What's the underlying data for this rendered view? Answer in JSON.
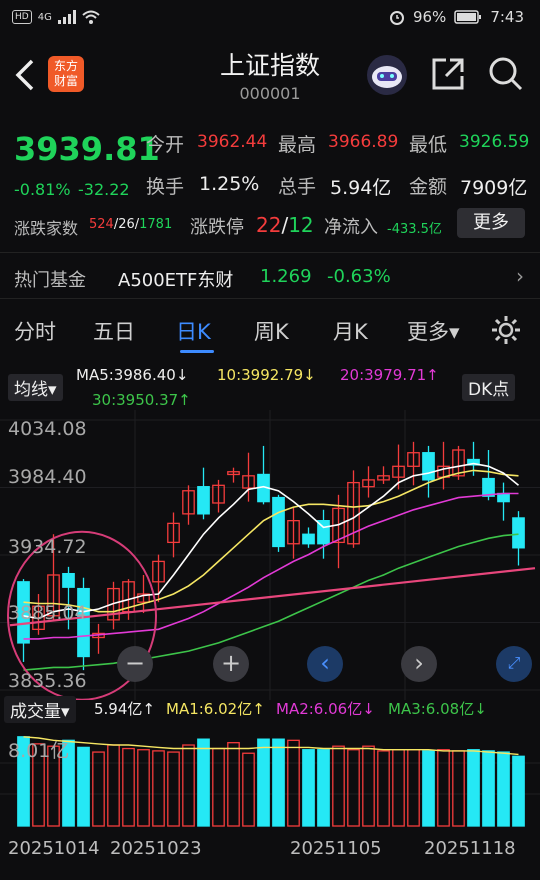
{
  "status": {
    "signal": "4G",
    "hd": "HD",
    "battery": "96%",
    "time": "7:43"
  },
  "header": {
    "logo_text_1": "东方",
    "logo_text_2": "财富",
    "title": "上证指数",
    "code": "000001"
  },
  "quote": {
    "price": "3939.81",
    "change_pct": "-0.81%",
    "change": "-32.22",
    "open_label": "今开",
    "open": "3962.44",
    "high_label": "最高",
    "high": "3966.89",
    "low_label": "最低",
    "low": "3926.59",
    "turnover_label": "换手",
    "turnover": "1.25%",
    "volume_label": "总手",
    "volume": "5.94亿",
    "amount_label": "金额",
    "amount": "7909亿",
    "breadth_label": "涨跌家数",
    "breadth_up": "524",
    "breadth_flat": "/26/",
    "breadth_down": "1781",
    "limit_label": "涨跌停",
    "limit_up": "22",
    "limit_sep": "/",
    "limit_down": "12",
    "netflow_label": "净流入",
    "netflow": "-433.5亿",
    "more_button": "更多"
  },
  "fund": {
    "label": "热门基金",
    "name": "A500ETF东财",
    "price": "1.269",
    "change": "-0.63%",
    "arrow": "›"
  },
  "tabs": {
    "items": [
      "分时",
      "五日",
      "日K",
      "周K",
      "月K",
      "更多▾"
    ],
    "active": "日K"
  },
  "chart": {
    "indicator_select": "均线▾",
    "ma5": "MA5:3986.40↓",
    "ma10": "10:3992.79↓",
    "ma20": "20:3979.71↑",
    "ma30": "30:3950.37↑",
    "dk_button": "DK点",
    "y_labels": [
      "4034.08",
      "3984.40",
      "3934.72",
      "3885.04",
      "3835.36"
    ],
    "volume_select": "成交量▾",
    "vol": "5.94亿↑",
    "vol_ma1": "MA1:6.02亿↑",
    "vol_ma2": "MA2:6.06亿↓",
    "vol_ma3": "MA3:6.08亿↓",
    "vol_axis": "8.01亿",
    "dates": [
      "20251014",
      "20251023",
      "20251105",
      "20251118"
    ],
    "colors": {
      "up": "#f43c3c",
      "down": "#25e8f5",
      "ma5": "#ffffff",
      "ma10": "#f5e663",
      "ma20": "#e23ad6",
      "ma30": "#3dc44a"
    }
  },
  "chart_data": {
    "type": "candlestick",
    "ylim": [
      3835.36,
      4034.08
    ],
    "candles": [
      {
        "o": 3915,
        "c": 3870,
        "h": 3917,
        "l": 3856
      },
      {
        "o": 3880,
        "c": 3897,
        "h": 3906,
        "l": 3876
      },
      {
        "o": 3890,
        "c": 3920,
        "h": 3950,
        "l": 3887
      },
      {
        "o": 3921,
        "c": 3911,
        "h": 3926,
        "l": 3880
      },
      {
        "o": 3910,
        "c": 3860,
        "h": 3918,
        "l": 3850
      },
      {
        "o": 3874,
        "c": 3877,
        "h": 3884,
        "l": 3862
      },
      {
        "o": 3887,
        "c": 3910,
        "h": 3915,
        "l": 3880
      },
      {
        "o": 3893,
        "c": 3915,
        "h": 3917,
        "l": 3887
      },
      {
        "o": 3900,
        "c": 3906,
        "h": 3920,
        "l": 3892
      },
      {
        "o": 3915,
        "c": 3930,
        "h": 3935,
        "l": 3900
      },
      {
        "o": 3944,
        "c": 3958,
        "h": 3966,
        "l": 3933
      },
      {
        "o": 3965,
        "c": 3982,
        "h": 3986,
        "l": 3957
      },
      {
        "o": 3985,
        "c": 3965,
        "h": 3999,
        "l": 3961
      },
      {
        "o": 3973,
        "c": 3986,
        "h": 3990,
        "l": 3966
      },
      {
        "o": 3994,
        "c": 3996,
        "h": 3999,
        "l": 3988
      },
      {
        "o": 3984,
        "c": 3993,
        "h": 4010,
        "l": 3974
      },
      {
        "o": 3994,
        "c": 3974,
        "h": 4015,
        "l": 3972
      },
      {
        "o": 3977,
        "c": 3941,
        "h": 3979,
        "l": 3937
      },
      {
        "o": 3943,
        "c": 3960,
        "h": 3970,
        "l": 3932
      },
      {
        "o": 3950,
        "c": 3943,
        "h": 3955,
        "l": 3940
      },
      {
        "o": 3960,
        "c": 3943,
        "h": 3968,
        "l": 3932
      },
      {
        "o": 3944,
        "c": 3969,
        "h": 3979,
        "l": 3925
      },
      {
        "o": 3943,
        "c": 3988,
        "h": 3997,
        "l": 3940
      },
      {
        "o": 3985,
        "c": 3990,
        "h": 4000,
        "l": 3977
      },
      {
        "o": 3990,
        "c": 3993,
        "h": 4000,
        "l": 3987
      },
      {
        "o": 3992,
        "c": 4000,
        "h": 4016,
        "l": 3983
      },
      {
        "o": 4000,
        "c": 4010,
        "h": 4018,
        "l": 3986
      },
      {
        "o": 4010,
        "c": 3990,
        "h": 4015,
        "l": 3977
      },
      {
        "o": 3992,
        "c": 4000,
        "h": 4018,
        "l": 3983
      },
      {
        "o": 3993,
        "c": 4012,
        "h": 4015,
        "l": 3990
      },
      {
        "o": 4005,
        "c": 4001,
        "h": 4018,
        "l": 3993
      },
      {
        "o": 3991,
        "c": 3978,
        "h": 4012,
        "l": 3975
      },
      {
        "o": 3980,
        "c": 3974,
        "h": 3988,
        "l": 3960
      },
      {
        "o": 3962,
        "c": 3940,
        "h": 3967,
        "l": 3927
      }
    ],
    "ma5": [
      3890,
      3888,
      3893,
      3895,
      3893,
      3895,
      3899,
      3902,
      3905,
      3906,
      3920,
      3935,
      3950,
      3962,
      3972,
      3983,
      3985,
      3982,
      3974,
      3965,
      3955,
      3957,
      3962,
      3970,
      3978,
      3988,
      3993,
      3995,
      3998,
      4000,
      4002,
      4000,
      3995,
      3986
    ],
    "ma10": [
      3900,
      3899,
      3899,
      3898,
      3896,
      3893,
      3893,
      3896,
      3899,
      3902,
      3906,
      3912,
      3920,
      3930,
      3940,
      3950,
      3960,
      3966,
      3970,
      3972,
      3972,
      3971,
      3970,
      3971,
      3974,
      3978,
      3983,
      3988,
      3992,
      3995,
      3997,
      3996,
      3994,
      3993
    ],
    "ma20": [
      3873,
      3873,
      3874,
      3874,
      3875,
      3876,
      3877,
      3878,
      3879,
      3880,
      3884,
      3888,
      3893,
      3899,
      3905,
      3911,
      3918,
      3924,
      3930,
      3935,
      3941,
      3946,
      3951,
      3956,
      3960,
      3964,
      3968,
      3971,
      3974,
      3977,
      3978,
      3979,
      3980,
      3980
    ],
    "ma30": [
      3850,
      3851,
      3852,
      3852,
      3853,
      3854,
      3855,
      3857,
      3858,
      3860,
      3862,
      3864,
      3867,
      3870,
      3874,
      3878,
      3882,
      3886,
      3891,
      3896,
      3901,
      3906,
      3911,
      3916,
      3920,
      3925,
      3929,
      3933,
      3937,
      3941,
      3944,
      3947,
      3949,
      3950
    ],
    "volume": [
      7.6,
      7.0,
      6.8,
      7.3,
      6.7,
      6.3,
      6.9,
      6.6,
      6.5,
      6.4,
      6.3,
      6.9,
      7.4,
      6.6,
      7.1,
      6.2,
      7.4,
      7.4,
      7.3,
      6.5,
      6.5,
      6.8,
      6.5,
      6.8,
      6.4,
      6.5,
      6.5,
      6.4,
      6.5,
      6.4,
      6.5,
      6.4,
      6.3,
      5.94
    ],
    "volume_ma": [
      7.6,
      7.5,
      7.3,
      7.2,
      7.1,
      7.0,
      6.9,
      6.9,
      6.8,
      6.7,
      6.6,
      6.6,
      6.6,
      6.6,
      6.6,
      6.6,
      6.7,
      6.7,
      6.7,
      6.7,
      6.6,
      6.6,
      6.6,
      6.6,
      6.5,
      6.5,
      6.5,
      6.5,
      6.4,
      6.4,
      6.4,
      6.3,
      6.2,
      6.1
    ]
  }
}
